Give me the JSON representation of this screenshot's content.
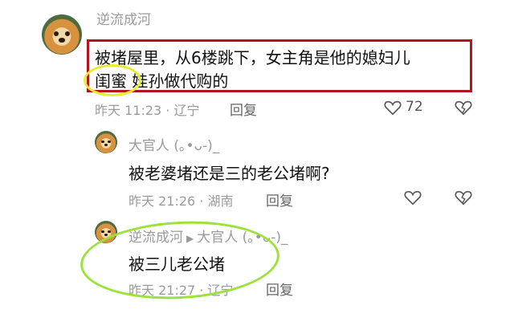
{
  "comments": [
    {
      "username": "逆流成河",
      "text_line1": "被堵屋里，从6楼跳下，女主角是他的媳妇儿",
      "text_line2": "闺蜜 娃孙做代购的",
      "time": "昨天 11:23 · 辽宁",
      "reply_label": "回复",
      "like_count": "72"
    },
    {
      "username": "大官人 (｡•ᴗ-)_",
      "text": "被老婆堵还是三的老公堵啊?",
      "time": "昨天 21:26 · 湖南",
      "reply_label": "回复"
    },
    {
      "username": "逆流成河",
      "reply_to": "大官人 (｡•ᴗ-)_",
      "text": "被三儿老公堵",
      "time": "昨天 21:27 · 辽宁",
      "reply_label": "回复"
    }
  ],
  "icons": {
    "like": "heart-icon",
    "dislike": "broken-heart-icon",
    "reply_arrow": "triangle-right-icon"
  },
  "colors": {
    "red_box": "#b3141d",
    "yellow_circle": "#e8ec2f",
    "green_circle": "#9be23a"
  }
}
